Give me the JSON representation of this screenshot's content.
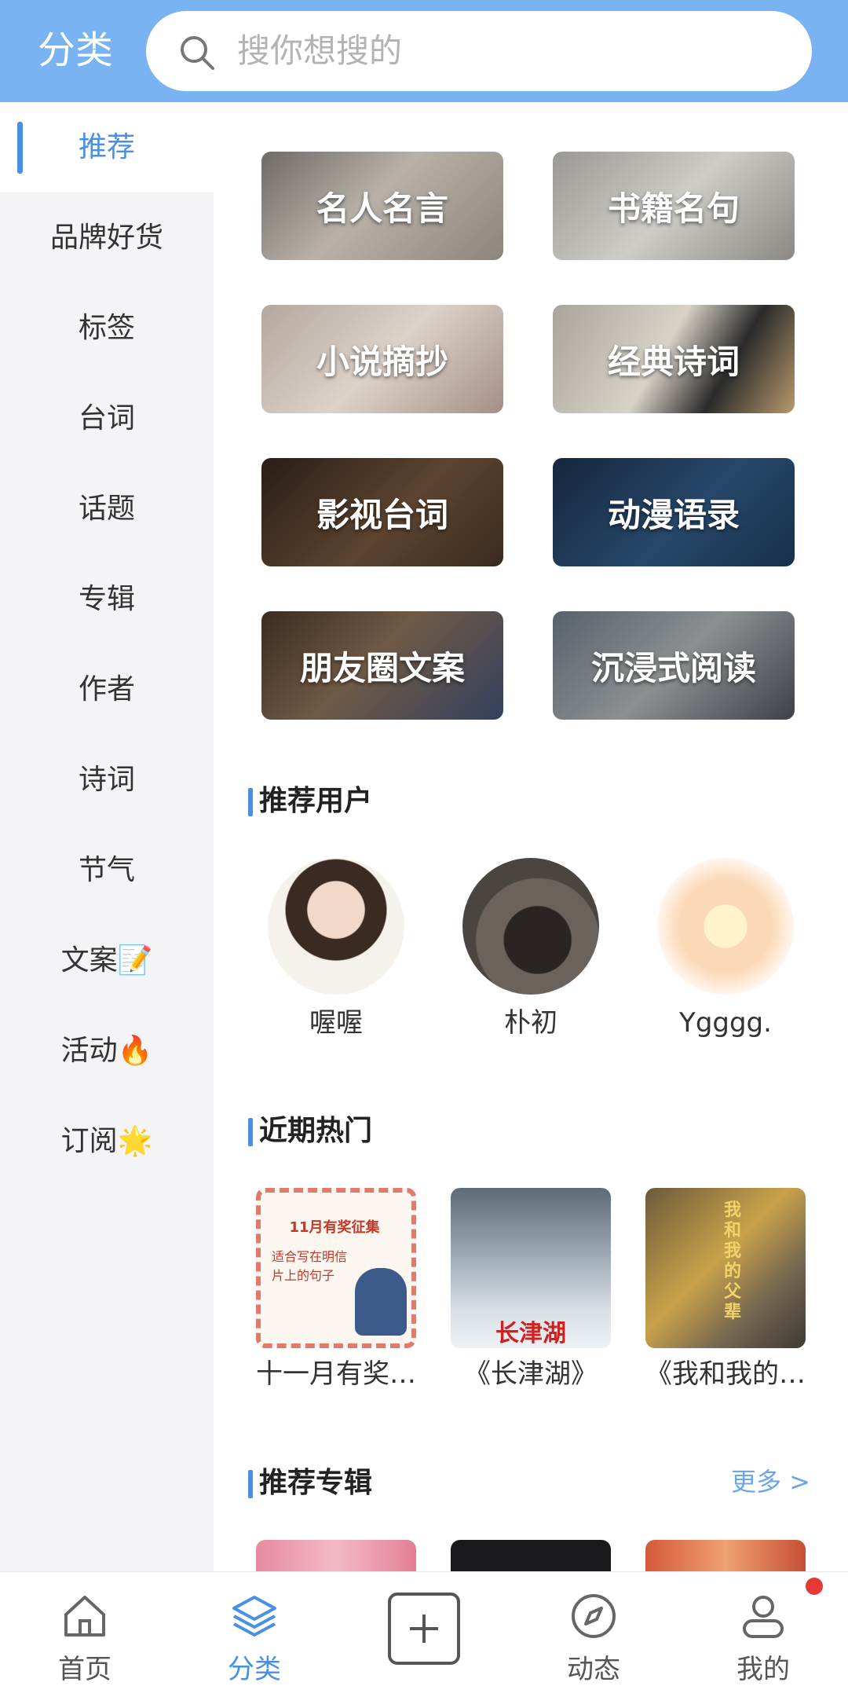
{
  "header": {
    "title": "分类",
    "search_placeholder": "搜你想搜的"
  },
  "sidebar": {
    "items": [
      {
        "label": "推荐",
        "active": true
      },
      {
        "label": "品牌好货"
      },
      {
        "label": "标签"
      },
      {
        "label": "台词"
      },
      {
        "label": "话题"
      },
      {
        "label": "专辑"
      },
      {
        "label": "作者"
      },
      {
        "label": "诗词"
      },
      {
        "label": "节气"
      },
      {
        "label": "文案📝"
      },
      {
        "label": "活动🔥"
      },
      {
        "label": "订阅🌟"
      }
    ]
  },
  "categories": [
    {
      "label": "名人名言"
    },
    {
      "label": "书籍名句"
    },
    {
      "label": "小说摘抄"
    },
    {
      "label": "经典诗词"
    },
    {
      "label": "影视台词"
    },
    {
      "label": "动漫语录"
    },
    {
      "label": "朋友圈文案"
    },
    {
      "label": "沉浸式阅读"
    }
  ],
  "recommended_users": {
    "title": "推荐用户",
    "users": [
      {
        "name": "喔喔"
      },
      {
        "name": "朴初"
      },
      {
        "name": "Ygggg."
      }
    ]
  },
  "hot": {
    "title": "近期热门",
    "items": [
      {
        "title": "十一月有奖征集",
        "thumb_text": "11月有奖征集",
        "thumb_subtext": "适合写在明信片上的句子"
      },
      {
        "title": "《长津湖》",
        "thumb_text": "长津湖"
      },
      {
        "title": "《我和我的父辈》",
        "thumb_text": "我和我的父辈"
      }
    ]
  },
  "albums": {
    "title": "推荐专辑",
    "more_label": "更多 >"
  },
  "bottom_nav": {
    "items": [
      {
        "label": "首页",
        "icon": "home-icon"
      },
      {
        "label": "分类",
        "icon": "layers-icon",
        "active": true
      },
      {
        "label": "",
        "icon": "plus-icon"
      },
      {
        "label": "动态",
        "icon": "compass-icon"
      },
      {
        "label": "我的",
        "icon": "user-icon"
      }
    ]
  },
  "colors": {
    "accent": "#4a90e2",
    "header": "#79b3f1",
    "badge": "#e53935"
  }
}
